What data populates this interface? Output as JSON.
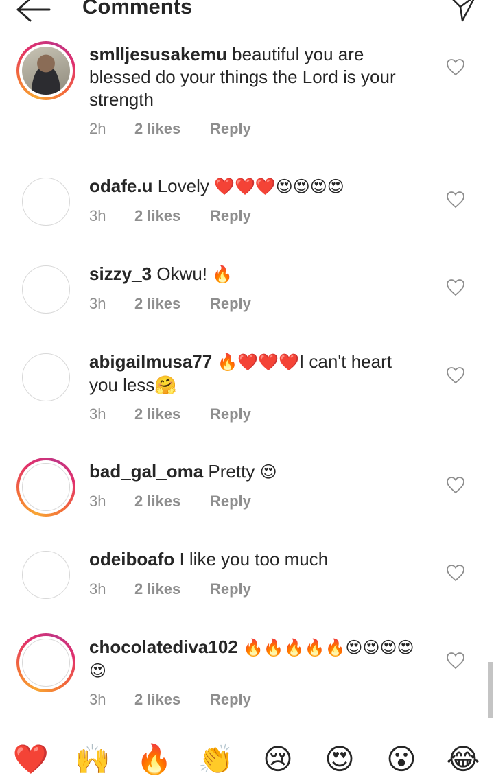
{
  "header": {
    "title": "Comments"
  },
  "comments": [
    {
      "username": "smlljesusakemu",
      "text": "beautiful you are blessed do your things the Lord is your strength",
      "emoji": "",
      "tail": "",
      "time": "2h",
      "likes": "2 likes",
      "reply": "Reply",
      "avatar": "photo-story"
    },
    {
      "username": "odafe.u",
      "text": "Lovely",
      "emoji": "❤️❤️❤️😍😍😍😍",
      "tail": "",
      "time": "3h",
      "likes": "2 likes",
      "reply": "Reply",
      "avatar": "empty"
    },
    {
      "username": "sizzy_3",
      "text": "Okwu!",
      "emoji": "🔥",
      "tail": "",
      "time": "3h",
      "likes": "2 likes",
      "reply": "Reply",
      "avatar": "empty"
    },
    {
      "username": "abigailmusa77",
      "text": "",
      "emoji": "🔥❤️❤️❤️",
      "tail": "I can't heart you  less🤗",
      "time": "3h",
      "likes": "2 likes",
      "reply": "Reply",
      "avatar": "empty"
    },
    {
      "username": "bad_gal_oma",
      "text": "Pretty",
      "emoji": "😍",
      "tail": "",
      "time": "3h",
      "likes": "2 likes",
      "reply": "Reply",
      "avatar": "story"
    },
    {
      "username": "odeiboafo",
      "text": "I like you too much",
      "emoji": "",
      "tail": "",
      "time": "3h",
      "likes": "2 likes",
      "reply": "Reply",
      "avatar": "empty"
    },
    {
      "username": "chocolatediva102",
      "text": "",
      "emoji": "🔥🔥🔥🔥🔥😍😍😍😍😍",
      "tail": "",
      "time": "3h",
      "likes": "2 likes",
      "reply": "Reply",
      "avatar": "story"
    }
  ],
  "quick_reactions": [
    "❤️",
    "🙌",
    "🔥",
    "👏",
    "😢",
    "😍",
    "😮",
    "😂"
  ],
  "colors": {
    "accent_heart": "#ed1c24",
    "meta_gray": "#8e8e8e",
    "text": "#262626"
  }
}
